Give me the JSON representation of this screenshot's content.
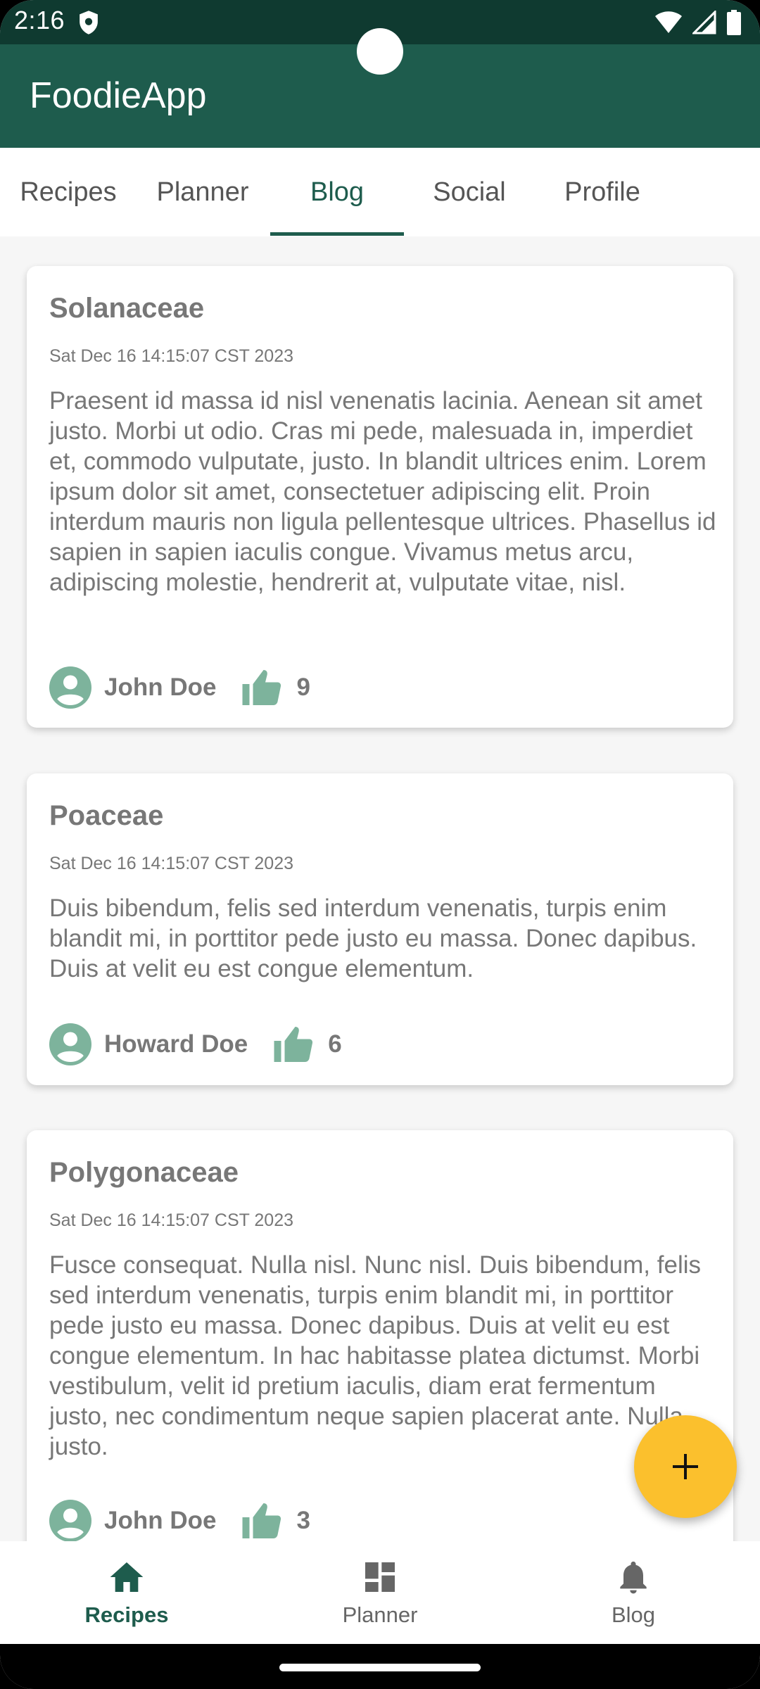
{
  "status_bar": {
    "time": "2:16",
    "icons": [
      "shield-icon",
      "wifi-icon",
      "signal-icon",
      "battery-icon"
    ]
  },
  "app": {
    "title": "FoodieApp"
  },
  "tabs": [
    {
      "label": "Recipes"
    },
    {
      "label": "Planner"
    },
    {
      "label": "Blog"
    },
    {
      "label": "Social"
    },
    {
      "label": "Profile"
    }
  ],
  "active_tab": "Blog",
  "posts": [
    {
      "title": "Solanaceae",
      "date": "Sat Dec 16 14:15:07 CST 2023",
      "body": "Praesent id massa id nisl venenatis lacinia. Aenean sit amet justo. Morbi ut odio. Cras mi pede, malesuada in, imperdiet et, commodo vulputate, justo. In blandit ultrices enim. Lorem ipsum dolor sit amet, consectetuer adipiscing elit. Proin interdum mauris non ligula pellentesque ultrices. Phasellus id sapien in sapien iaculis congue. Vivamus metus arcu, adipiscing molestie, hendrerit at, vulputate vitae, nisl.",
      "author": "John Doe",
      "likes": "9"
    },
    {
      "title": "Poaceae",
      "date": "Sat Dec 16 14:15:07 CST 2023",
      "body": "Duis bibendum, felis sed interdum venenatis, turpis enim blandit mi, in porttitor pede justo eu massa. Donec dapibus. Duis at velit eu est congue elementum.",
      "author": "Howard Doe",
      "likes": "6"
    },
    {
      "title": "Polygonaceae",
      "date": "Sat Dec 16 14:15:07 CST 2023",
      "body": "Fusce consequat. Nulla nisl. Nunc nisl. Duis bibendum, felis sed interdum venenatis, turpis enim blandit mi, in porttitor pede justo eu massa. Donec dapibus. Duis at velit eu est congue elementum. In hac habitasse platea dictumst. Morbi vestibulum, velit id pretium iaculis, diam erat fermentum justo, nec condimentum neque sapien placerat ante. Nulla justo.",
      "author": "John Doe",
      "likes": "3"
    }
  ],
  "fab": {
    "icon": "plus-icon"
  },
  "bottom_nav": [
    {
      "label": "Recipes",
      "icon": "home-icon"
    },
    {
      "label": "Planner",
      "icon": "dashboard-icon"
    },
    {
      "label": "Blog",
      "icon": "bell-icon"
    }
  ],
  "active_bottom_nav": "Recipes",
  "colors": {
    "primary": "#1e5c4d",
    "status_bar": "#0f3a30",
    "accent_fab": "#fbc02d",
    "icon_tint": "#7db39c",
    "text_muted": "#777777"
  }
}
